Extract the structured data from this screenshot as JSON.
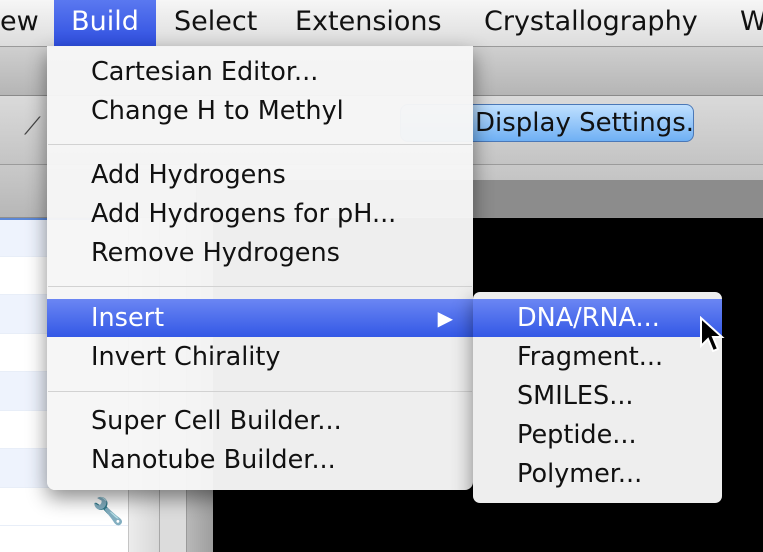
{
  "menubar": {
    "items": [
      "ew",
      "Build",
      "Select",
      "Extensions",
      "Crystallography",
      "W"
    ]
  },
  "toolbar": {
    "display_settings_label": "Display Settings..."
  },
  "build_menu": {
    "items": [
      "Cartesian Editor...",
      "Change H to Methyl",
      "Add Hydrogens",
      "Add Hydrogens for pH...",
      "Remove Hydrogens",
      "Insert",
      "Invert Chirality",
      "Super Cell Builder...",
      "Nanotube Builder..."
    ]
  },
  "insert_submenu": {
    "items": [
      "DNA/RNA...",
      "Fragment...",
      "SMILES...",
      "Peptide...",
      "Polymer..."
    ]
  },
  "icons": [
    "tool-icon",
    "wrench-icon",
    "submenu-arrow-icon",
    "mouse-cursor-icon"
  ],
  "colors": {
    "highlight": "#3f62ea",
    "viewer": "#000000"
  }
}
